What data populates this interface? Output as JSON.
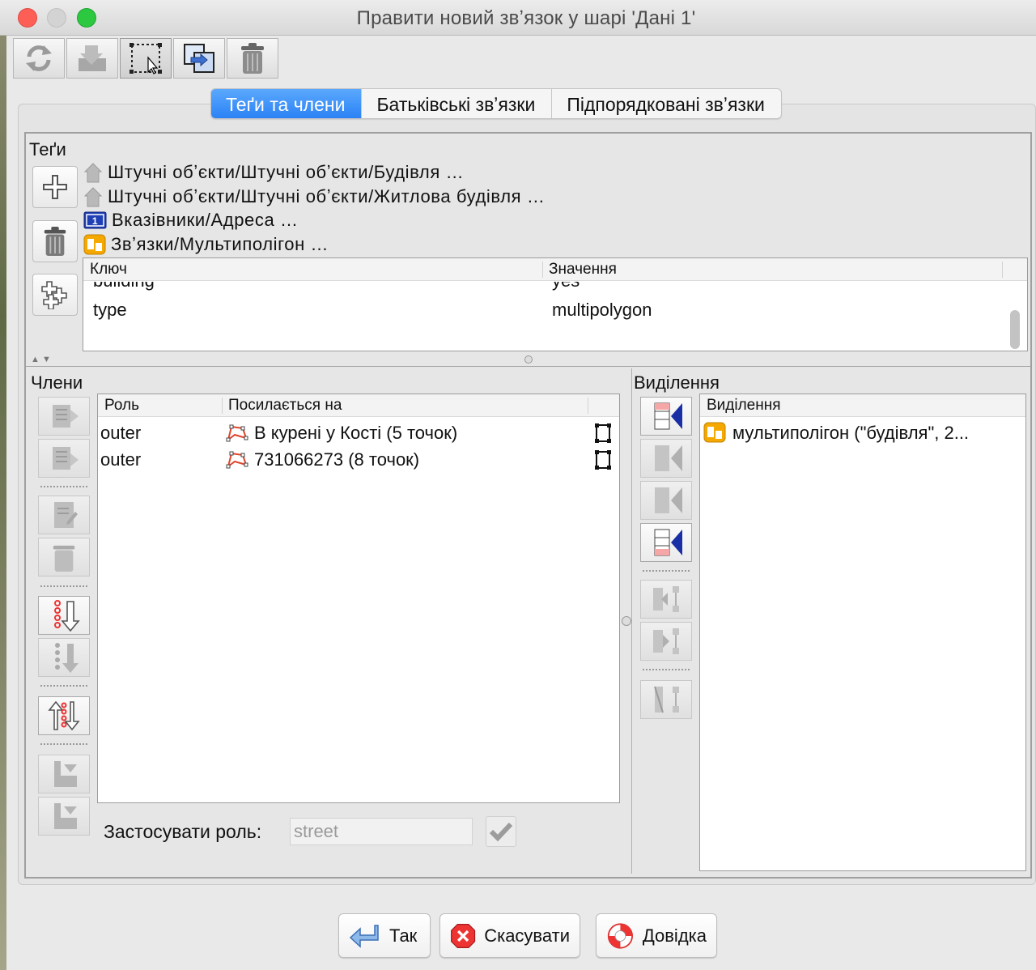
{
  "window": {
    "title": "Правити новий звʼязок у шарі 'Дані 1'"
  },
  "toolbar": {
    "items": [
      {
        "icon": "refresh-icon"
      },
      {
        "icon": "download-icon"
      },
      {
        "icon": "select-members-icon"
      },
      {
        "icon": "duplicate-icon"
      },
      {
        "icon": "trash-icon"
      }
    ]
  },
  "tabs": [
    {
      "label": "Теґи та члени",
      "active": true
    },
    {
      "label": "Батьківські звʼязки",
      "active": false
    },
    {
      "label": "Підпорядковані звʼязки",
      "active": false
    }
  ],
  "tags": {
    "heading": "Теґи",
    "presets": [
      {
        "icon": "house-icon",
        "text": "Штучні обʼєкти/Штучні обʼєкти/Будівля …"
      },
      {
        "icon": "house-icon",
        "text": "Штучні обʼєкти/Штучні обʼєкти/Житлова будівля …"
      },
      {
        "icon": "address-sign-icon",
        "text": "Вказівники/Адреса …"
      },
      {
        "icon": "multipolygon-icon",
        "text": "Звʼязки/Мультиполігон …"
      }
    ],
    "table": {
      "headers": {
        "key": "Ключ",
        "value": "Значення"
      },
      "rows": [
        {
          "key": "building",
          "value": "yes"
        },
        {
          "key": "type",
          "value": "multipolygon"
        }
      ]
    }
  },
  "members": {
    "heading": "Члени",
    "table": {
      "headers": {
        "role": "Роль",
        "refers": "Посилається на"
      },
      "rows": [
        {
          "role": "outer",
          "refers": "В курені у Кості (5 точок)"
        },
        {
          "role": "outer",
          "refers": "731066273 (8 точок)"
        }
      ]
    },
    "apply_role": {
      "label": "Застосувати роль:",
      "placeholder": "street"
    }
  },
  "selection": {
    "heading": "Виділення",
    "table": {
      "header": "Виділення",
      "rows": [
        {
          "icon": "multipolygon-icon",
          "text": "мультиполігон (\"будівля\", 2..."
        }
      ]
    }
  },
  "buttons": {
    "ok": "Так",
    "cancel": "Скасувати",
    "help": "Довідка"
  },
  "colors": {
    "tab_active": "#2c82f5",
    "close": "#fd5f57",
    "maximize": "#2bc840",
    "multipolygon": "#f5a800",
    "member_way": "#e0452b"
  }
}
